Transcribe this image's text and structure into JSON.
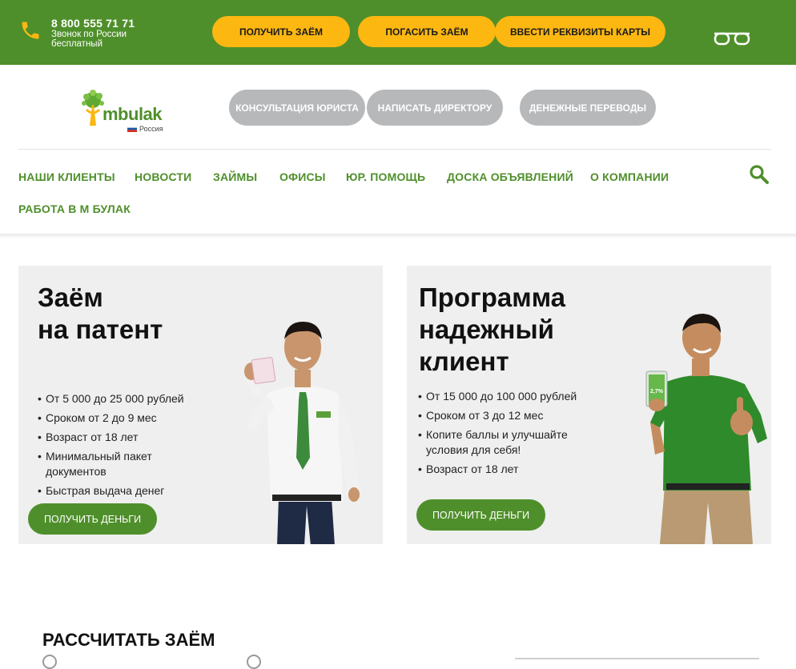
{
  "header": {
    "phone": "8 800 555 71 71",
    "phone_sub": "Звонок по России бесплатный",
    "buttons": [
      "ПОЛУЧИТЬ ЗАЁМ",
      "ПОГАСИТЬ ЗАЁМ",
      "ВВЕСТИ РЕКВИЗИТЫ КАРТЫ"
    ],
    "accessibility_icon": "glasses-icon"
  },
  "logo": {
    "text": "mbulak",
    "sub": "Россия"
  },
  "service_buttons": [
    "КОНСУЛЬТАЦИЯ ЮРИСТА",
    "НАПИСАТЬ ДИРЕКТОРУ",
    "ДЕНЕЖНЫЕ ПЕРЕВОДЫ"
  ],
  "nav": {
    "items": [
      "НАШИ КЛИЕНТЫ",
      "НОВОСТИ",
      "ЗАЙМЫ",
      "ОФИСЫ",
      "ЮР. ПОМОЩЬ",
      "ДОСКА ОБЪЯВЛЕНИЙ",
      "О КОМПАНИИ",
      "РАБОТА В М БУЛАК"
    ],
    "search_icon": "search-icon"
  },
  "cards": [
    {
      "title_line1": "Заём",
      "title_line2": "на патент",
      "bullets": [
        "От 5 000 до 25 000 рублей",
        "Сроком от 2 до 9 мес",
        "Возраст от 18 лет",
        "Минимальный пакет документов",
        "Быстрая выдача денег"
      ],
      "cta": "ПОЛУЧИТЬ ДЕНЬГИ"
    },
    {
      "title_line1": "Программа",
      "title_line2": "надежный",
      "title_line3": "клиент",
      "bullets": [
        "От 15 000 до 100 000 рублей",
        "Сроком от 3 до 12 мес",
        "Копите баллы и улучшайте условия для себя!",
        "Возраст от 18 лет"
      ],
      "cta": "ПОЛУЧИТЬ ДЕНЬГИ",
      "phone_screen_text": "2,7%"
    }
  ],
  "calculator": {
    "title": "РАССЧИТАТЬ ЗАЁМ"
  },
  "colors": {
    "brand_green": "#4f8f2b",
    "accent_yellow": "#fcb711",
    "grey_button": "#b6b8ba",
    "card_bg": "#eeefee"
  }
}
